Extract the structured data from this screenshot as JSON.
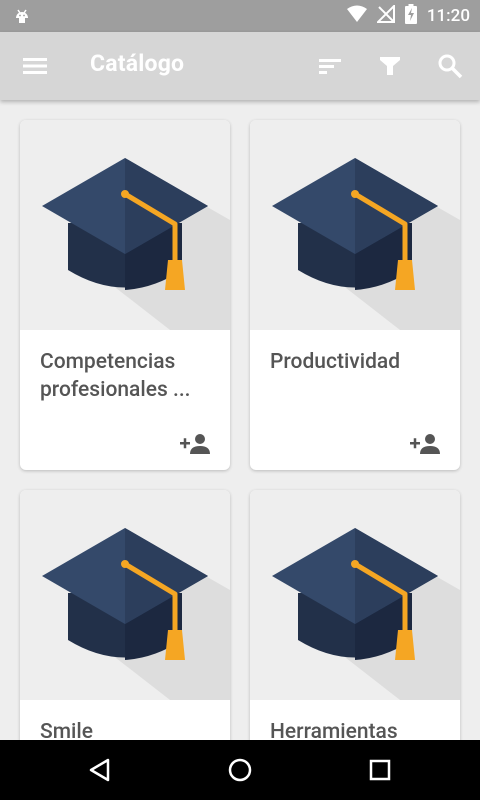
{
  "status_bar": {
    "time": "11:20",
    "icons": [
      "android-debug-icon",
      "wifi-icon",
      "no-sim-icon",
      "battery-charging-icon"
    ]
  },
  "app_bar": {
    "title": "Catálogo",
    "actions": [
      "menu-icon",
      "sort-icon",
      "filter-icon",
      "search-icon"
    ]
  },
  "catalog": {
    "cards": [
      {
        "name": "Competencias profesionales ...",
        "icon": "graduation-cap-icon",
        "action_icon": "person-add-icon"
      },
      {
        "name": "Productividad",
        "icon": "graduation-cap-icon",
        "action_icon": "person-add-icon"
      },
      {
        "name": "Smile",
        "icon": "graduation-cap-icon",
        "action_icon": "person-add-icon"
      },
      {
        "name": "Herramientas",
        "icon": "graduation-cap-icon",
        "action_icon": "person-add-icon"
      }
    ]
  },
  "nav_bar": {
    "buttons": [
      "back-icon",
      "home-icon",
      "recents-icon"
    ]
  },
  "colors": {
    "status_bar": "#9e9e9e",
    "app_bar": "#d6d6d6",
    "background": "#eeeeee",
    "cap_dark": "#2f3f57",
    "tassel": "#f5a623"
  }
}
